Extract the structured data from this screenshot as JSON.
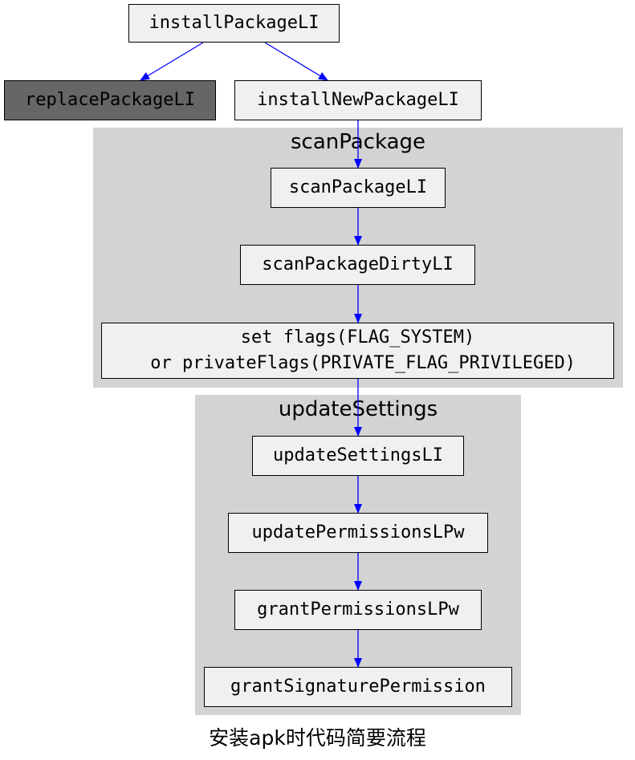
{
  "clusters": {
    "scan": {
      "title": "scanPackage"
    },
    "update": {
      "title": "updateSettings"
    }
  },
  "nodes": {
    "install_package": "installPackageLI",
    "replace_package": "replacePackageLI",
    "install_new_package": "installNewPackageLI",
    "scan_package": "scanPackageLI",
    "scan_package_dirty": "scanPackageDirtyLI",
    "set_flags": "set flags(FLAG_SYSTEM)\n or privateFlags(PRIVATE_FLAG_PRIVILEGED)",
    "update_settings": "updateSettingsLI",
    "update_permissions": "updatePermissionsLPw",
    "grant_permissions": "grantPermissionsLPw",
    "grant_signature_permission": "grantSignaturePermission"
  },
  "caption": "安装apk时代码简要流程",
  "colors": {
    "edge": "#0000ff",
    "cluster_fill": "#d3d3d3",
    "node_fill": "#f0f0f0",
    "highlight_node_fill": "#666666"
  }
}
